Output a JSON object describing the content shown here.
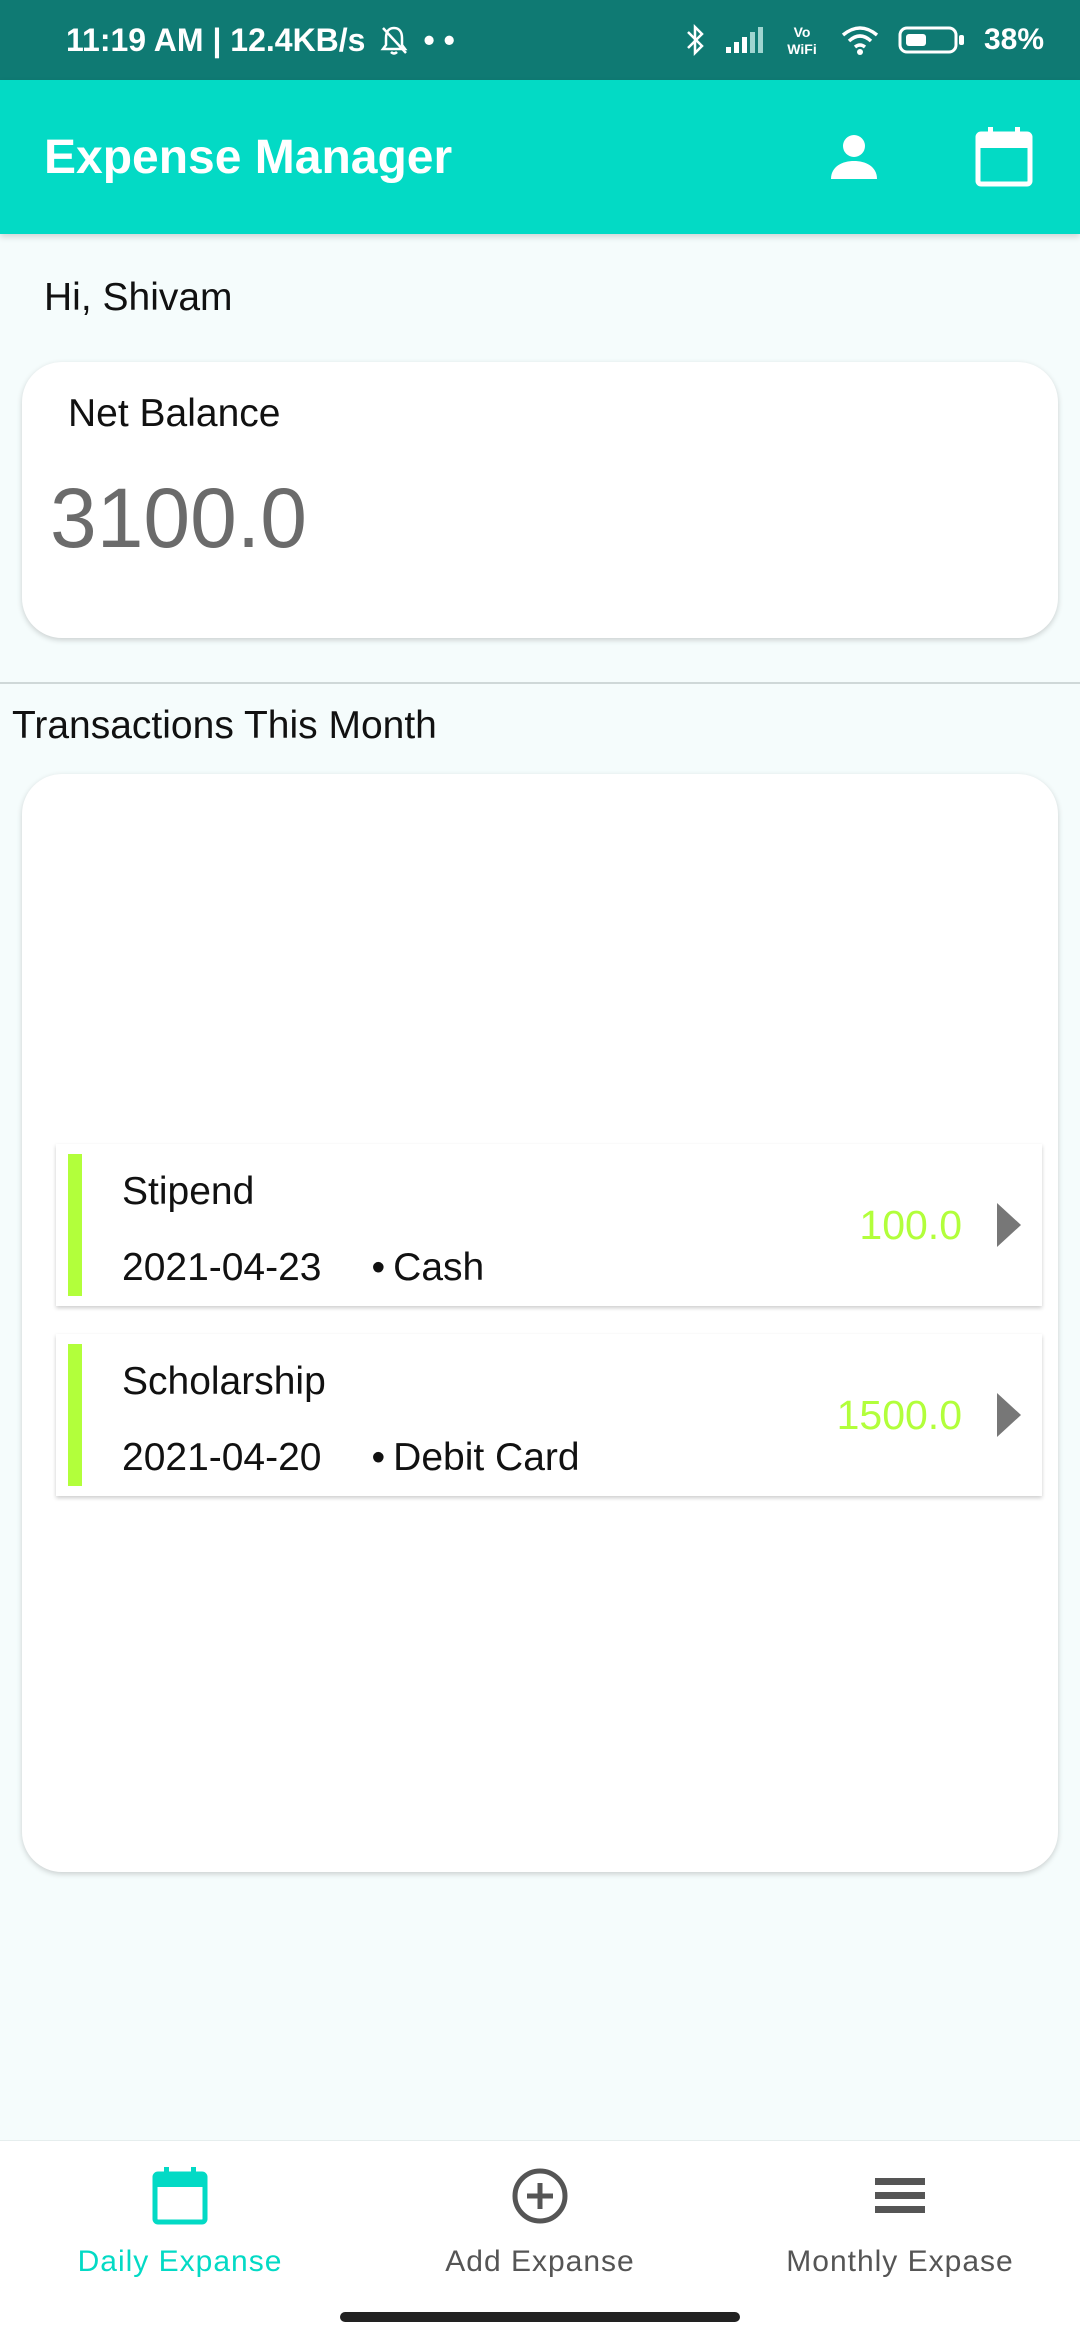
{
  "status_bar": {
    "time": "11:19 AM | 12.4KB/s",
    "dots": "• •",
    "battery": "38%"
  },
  "app_bar": {
    "title": "Expense Manager"
  },
  "greeting": "Hi, Shivam",
  "balance": {
    "label": "Net Balance",
    "value": "3100.0"
  },
  "transactions": {
    "title": "Transactions This Month",
    "items": [
      {
        "name": "Stipend",
        "date": "2021-04-23",
        "method": "Cash",
        "amount": "100.0"
      },
      {
        "name": "Scholarship",
        "date": "2021-04-20",
        "method": "Debit Card",
        "amount": "1500.0"
      }
    ]
  },
  "bottom_nav": {
    "items": [
      {
        "label": "Daily Expanse",
        "icon": "calendar-icon",
        "active": true
      },
      {
        "label": "Add Expanse",
        "icon": "add-circle-icon",
        "active": false
      },
      {
        "label": "Monthly Expase",
        "icon": "menu-icon",
        "active": false
      }
    ]
  },
  "colors": {
    "accent": "#03dac5",
    "status_bar": "#0f7a73",
    "income": "#b2ff3b"
  }
}
